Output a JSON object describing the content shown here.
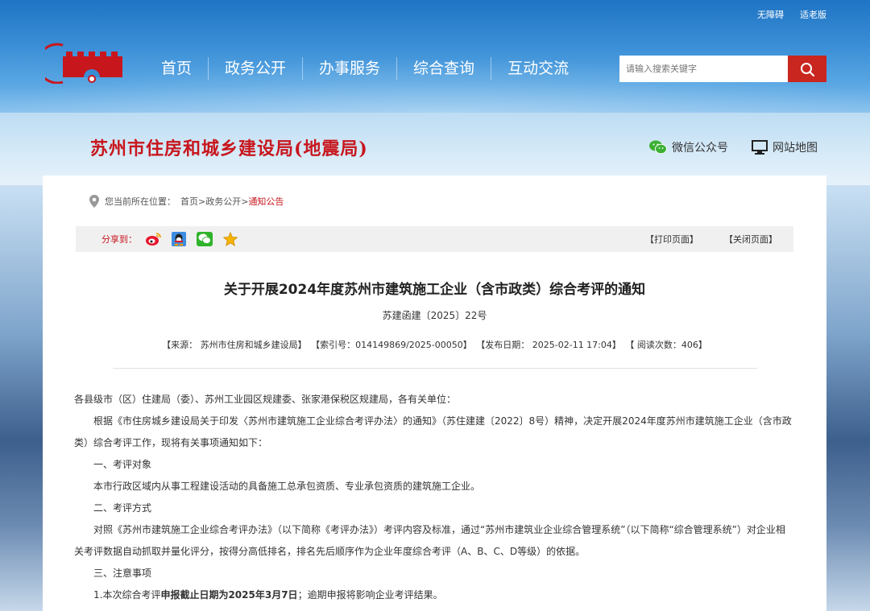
{
  "top_links": {
    "accessible": "无障碍",
    "elder": "适老版"
  },
  "nav": {
    "items": [
      "首页",
      "政务公开",
      "办事服务",
      "综合查询",
      "互动交流"
    ]
  },
  "search": {
    "placeholder": "请输入搜索关键字"
  },
  "site": {
    "title": "苏州市住房和城乡建设局(地震局)"
  },
  "quick_links": {
    "wechat": "微信公众号",
    "sitemap": "网站地图"
  },
  "breadcrumb": {
    "prefix": "您当前所在位置：",
    "home": "首页",
    "sep1": ">",
    "section": "政务公开",
    "sep2": ">",
    "current": "通知公告"
  },
  "share": {
    "label": "分享到：",
    "print": "【打印页面】",
    "close": "【关闭页面】"
  },
  "article": {
    "title": "关于开展2024年度苏州市建筑施工企业（含市政类）综合考评的通知",
    "doc_number": "苏建函建〔2025〕22号",
    "meta": {
      "source": "【来源：  苏州市住房和城乡建设局】",
      "index": "【索引号：014149869/2025-00050】",
      "date": "【发布日期：  2025-02-11 17:04】",
      "views": "【 阅读次数：406】"
    },
    "p1": "各县级市（区）住建局（委）、苏州工业园区规建委、张家港保税区规建局，各有关单位：",
    "p2": "根据《市住房城乡建设局关于印发〈苏州市建筑施工企业综合考评办法〉的通知》（苏住建建〔2022〕8号）精神，决定开展2024年度苏州市建筑施工企业（含市政类）综合考评工作，现将有关事项通知如下：",
    "h1": "一、考评对象",
    "p3": "本市行政区域内从事工程建设活动的具备施工总承包资质、专业承包资质的建筑施工企业。",
    "h2": "二、考评方式",
    "p4": "对照《苏州市建筑施工企业综合考评办法》（以下简称《考评办法》）考评内容及标准，通过“苏州市建筑业企业综合管理系统”（以下简称“综合管理系统”）对企业相关考评数据自动抓取并量化评分，按得分高低排名，排名先后顺序作为企业年度综合考评（A、B、C、D等级）的依据。",
    "h3": "三、注意事项",
    "p5_pre": "1.本次综合考评",
    "p5_bold": "申报截止日期为2025年3月7日",
    "p5_post": "；逾期申报将影响企业考评结果。"
  },
  "colors": {
    "brand_red": "#c8161d",
    "header_blue": "#2f86d2",
    "search_btn": "#c9261f"
  }
}
